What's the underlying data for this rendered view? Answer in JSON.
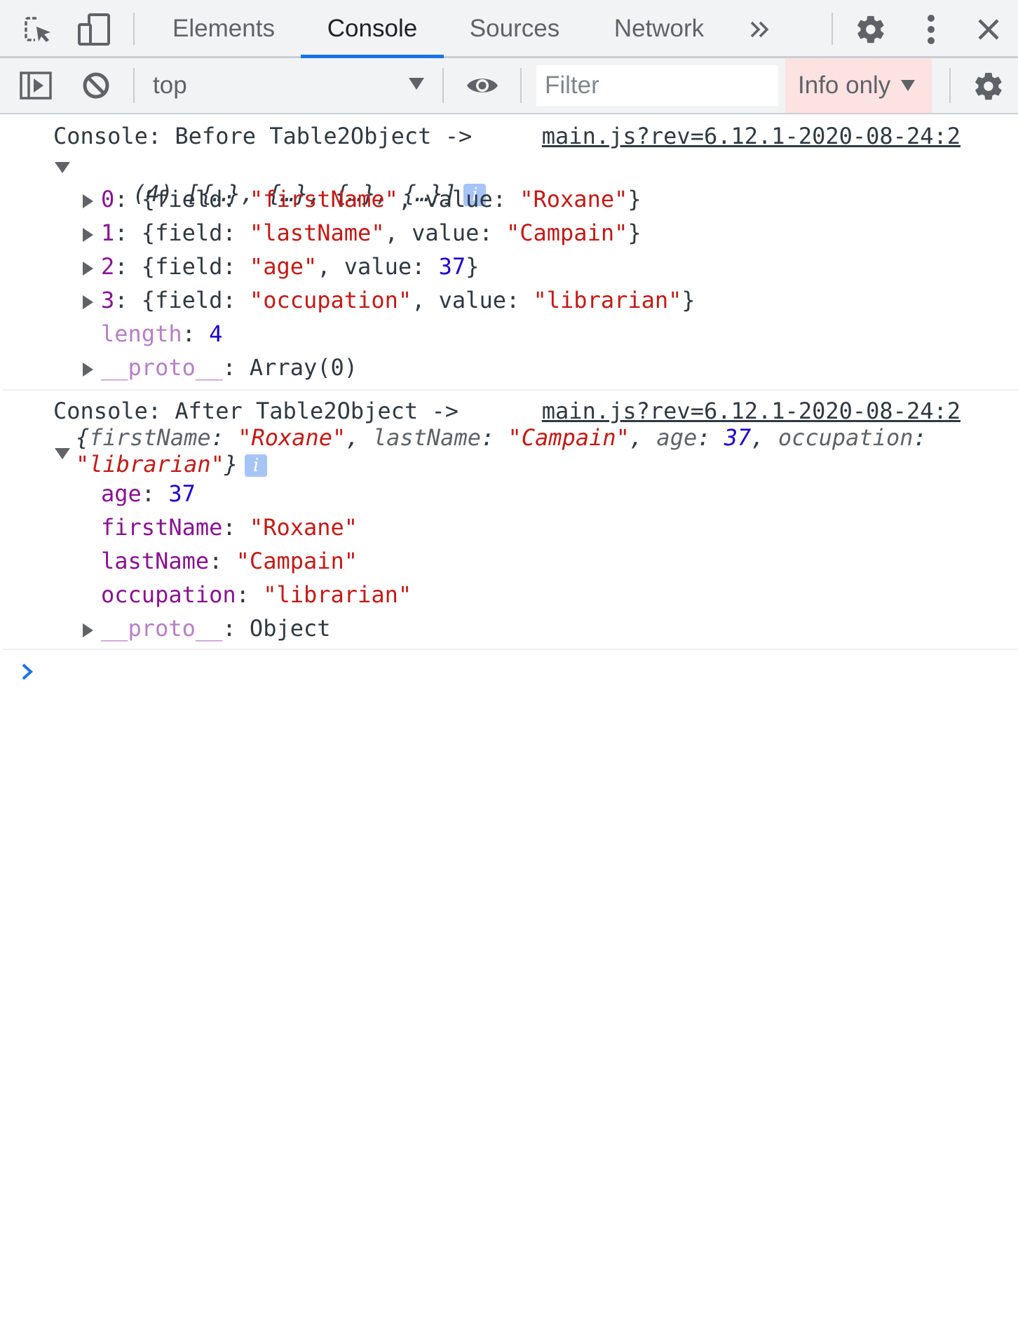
{
  "tabbar": {
    "tabs": [
      {
        "label": "Elements",
        "active": false
      },
      {
        "label": "Console",
        "active": true
      },
      {
        "label": "Sources",
        "active": false
      },
      {
        "label": "Network",
        "active": false
      }
    ],
    "more_label": "»",
    "icons": [
      "inspect-element-icon",
      "device-toggle-icon",
      "more-tabs-icon",
      "settings-gear-icon",
      "kebab-menu-icon",
      "close-icon"
    ],
    "accent_color": "#1a73e8"
  },
  "toolbar": {
    "context": "top",
    "filter_placeholder": "Filter",
    "filter_value": "",
    "levels": "Info only",
    "levels_bg": "#fde2e2",
    "icons": [
      "sidebar-toggle-icon",
      "clear-console-icon",
      "eye-icon",
      "console-settings-gear-icon"
    ]
  },
  "messages": [
    {
      "text": "Console: Before Table2Object ->",
      "source": "main.js?rev=6.12.1-2020-08-24:2",
      "summary": {
        "prefix": "(4) [{…}, {…}, {…}, {…}]",
        "info": "i"
      },
      "items": [
        {
          "index": "0",
          "field": "\"firstName\"",
          "value": "\"Roxane\"",
          "value_type": "string"
        },
        {
          "index": "1",
          "field": "\"lastName\"",
          "value": "\"Campain\"",
          "value_type": "string"
        },
        {
          "index": "2",
          "field": "\"age\"",
          "value": "37",
          "value_type": "number"
        },
        {
          "index": "3",
          "field": "\"occupation\"",
          "value": "\"librarian\"",
          "value_type": "string"
        }
      ],
      "length_key": "length",
      "length_value": "4",
      "proto_key": "__proto__",
      "proto_value": "Array(0)"
    },
    {
      "text": "Console: After Table2Object ->",
      "source": "main.js?rev=6.12.1-2020-08-24:2",
      "summary": {
        "k1": "firstName",
        "v1": "\"Roxane\"",
        "k2": "lastName",
        "v2": "\"Campain\"",
        "k3": "age",
        "v3": "37",
        "k4": "occupation",
        "v4": "\"librarian\"",
        "info": "i"
      },
      "props": [
        {
          "key": "age",
          "value": "37",
          "value_type": "number"
        },
        {
          "key": "firstName",
          "value": "\"Roxane\"",
          "value_type": "string"
        },
        {
          "key": "lastName",
          "value": "\"Campain\"",
          "value_type": "string"
        },
        {
          "key": "occupation",
          "value": "\"librarian\"",
          "value_type": "string"
        }
      ],
      "proto_key": "__proto__",
      "proto_value": "Object"
    }
  ],
  "prompt_symbol": "›"
}
